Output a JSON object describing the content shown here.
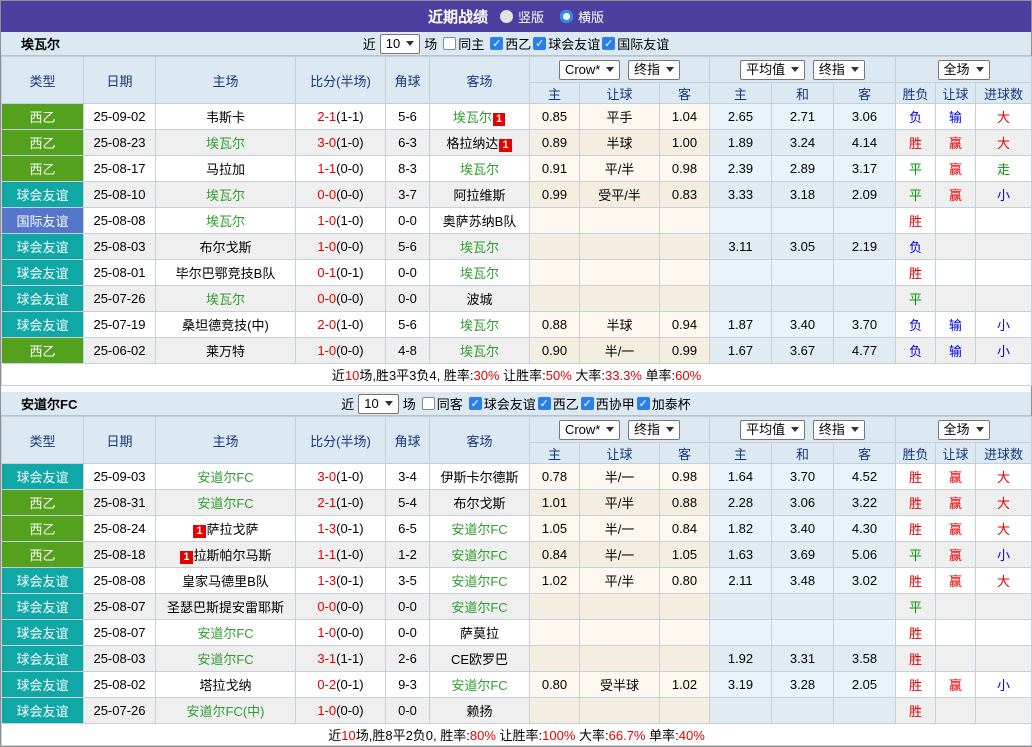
{
  "title_bar": {
    "title": "近期战绩",
    "vertical_label": "竖版",
    "horizontal_label": "横版"
  },
  "filter_shared": {
    "near_label": "近",
    "count": "10",
    "games_label": "场"
  },
  "table_header": {
    "col_type": "类型",
    "col_date": "日期",
    "col_home": "主场",
    "col_score": "比分(半场)",
    "col_corner": "角球",
    "col_away": "客场",
    "dd_odds": "Crow*",
    "dd_final": "终指",
    "dd_avg": "平均值",
    "dd_scope": "全场",
    "odds_sub": [
      "主",
      "让球",
      "客"
    ],
    "avg_sub": [
      "主",
      "和",
      "客"
    ],
    "result_sub": [
      "胜负",
      "让球",
      "进球数"
    ]
  },
  "colors": {
    "accent_purple": "#4b3fa0",
    "league_green": "#54a11e",
    "league_teal": "#10a7a7",
    "league_blue": "#5576cb",
    "win_red": "#e60000",
    "lose_blue": "#0000e0",
    "draw_green": "#009900",
    "team_green": "#2f9e2f"
  },
  "sections": [
    {
      "team": "埃瓦尔",
      "filter": {
        "same": "同主",
        "same_checked": false,
        "leagues": [
          "西乙",
          "球会友谊",
          "国际友谊"
        ]
      },
      "rows": [
        {
          "type": "西乙",
          "tc": "g",
          "date": "25-09-02",
          "home": {
            "t": "韦斯卡"
          },
          "score": "2-1",
          "half": "(1-1)",
          "corner": "5-6",
          "away": {
            "t": "埃瓦尔",
            "g": 1,
            "card": "1",
            "cpos": "after"
          },
          "o": [
            "0.85",
            "平手",
            "1.04"
          ],
          "a": [
            "2.65",
            "2.71",
            "3.06"
          ],
          "r": [
            [
              "负",
              "b"
            ],
            [
              "输",
              "b"
            ],
            [
              "大",
              "r"
            ]
          ]
        },
        {
          "type": "西乙",
          "tc": "g",
          "date": "25-08-23",
          "home": {
            "t": "埃瓦尔",
            "g": 1
          },
          "score": "3-0",
          "half": "(1-0)",
          "corner": "6-3",
          "away": {
            "t": "格拉纳达",
            "card": "1",
            "cpos": "after"
          },
          "o": [
            "0.89",
            "半球",
            "1.00"
          ],
          "a": [
            "1.89",
            "3.24",
            "4.14"
          ],
          "r": [
            [
              "胜",
              "r"
            ],
            [
              "赢",
              "r"
            ],
            [
              "大",
              "r"
            ]
          ]
        },
        {
          "type": "西乙",
          "tc": "g",
          "date": "25-08-17",
          "home": {
            "t": "马拉加"
          },
          "score": "1-1",
          "half": "(0-0)",
          "corner": "8-3",
          "away": {
            "t": "埃瓦尔",
            "g": 1
          },
          "o": [
            "0.91",
            "平/半",
            "0.98"
          ],
          "a": [
            "2.39",
            "2.89",
            "3.17"
          ],
          "r": [
            [
              "平",
              "g"
            ],
            [
              "赢",
              "r"
            ],
            [
              "走",
              "g"
            ]
          ]
        },
        {
          "type": "球会友谊",
          "tc": "t",
          "date": "25-08-10",
          "home": {
            "t": "埃瓦尔",
            "g": 1
          },
          "score": "0-0",
          "half": "(0-0)",
          "corner": "3-7",
          "away": {
            "t": "阿拉维斯"
          },
          "o": [
            "0.99",
            "受平/半",
            "0.83"
          ],
          "a": [
            "3.33",
            "3.18",
            "2.09"
          ],
          "r": [
            [
              "平",
              "g"
            ],
            [
              "赢",
              "r"
            ],
            [
              "小",
              "b"
            ]
          ]
        },
        {
          "type": "国际友谊",
          "tc": "b",
          "date": "25-08-08",
          "home": {
            "t": "埃瓦尔",
            "g": 1
          },
          "score": "1-0",
          "half": "(1-0)",
          "corner": "0-0",
          "away": {
            "t": "奥萨苏纳B队"
          },
          "o": [
            "",
            "",
            ""
          ],
          "a": [
            "",
            "",
            ""
          ],
          "r": [
            [
              "胜",
              "r"
            ],
            [
              "",
              ""
            ],
            [
              "",
              ""
            ]
          ]
        },
        {
          "type": "球会友谊",
          "tc": "t",
          "date": "25-08-03",
          "home": {
            "t": "布尔戈斯"
          },
          "score": "1-0",
          "half": "(0-0)",
          "corner": "5-6",
          "away": {
            "t": "埃瓦尔",
            "g": 1
          },
          "o": [
            "",
            "",
            ""
          ],
          "a": [
            "3.11",
            "3.05",
            "2.19"
          ],
          "r": [
            [
              "负",
              "b"
            ],
            [
              "",
              ""
            ],
            [
              "",
              ""
            ]
          ]
        },
        {
          "type": "球会友谊",
          "tc": "t",
          "date": "25-08-01",
          "home": {
            "t": "毕尔巴鄂竞技B队"
          },
          "score": "0-1",
          "half": "(0-1)",
          "corner": "0-0",
          "away": {
            "t": "埃瓦尔",
            "g": 1
          },
          "o": [
            "",
            "",
            ""
          ],
          "a": [
            "",
            "",
            ""
          ],
          "r": [
            [
              "胜",
              "r"
            ],
            [
              "",
              ""
            ],
            [
              "",
              ""
            ]
          ]
        },
        {
          "type": "球会友谊",
          "tc": "t",
          "date": "25-07-26",
          "home": {
            "t": "埃瓦尔",
            "g": 1
          },
          "score": "0-0",
          "half": "(0-0)",
          "corner": "0-0",
          "away": {
            "t": "波城"
          },
          "o": [
            "",
            "",
            ""
          ],
          "a": [
            "",
            "",
            ""
          ],
          "r": [
            [
              "平",
              "g"
            ],
            [
              "",
              ""
            ],
            [
              "",
              ""
            ]
          ]
        },
        {
          "type": "球会友谊",
          "tc": "t",
          "date": "25-07-19",
          "home": {
            "t": "桑坦德竞技(中)"
          },
          "score": "2-0",
          "half": "(1-0)",
          "corner": "5-6",
          "away": {
            "t": "埃瓦尔",
            "g": 1
          },
          "o": [
            "0.88",
            "半球",
            "0.94"
          ],
          "a": [
            "1.87",
            "3.40",
            "3.70"
          ],
          "r": [
            [
              "负",
              "b"
            ],
            [
              "输",
              "b"
            ],
            [
              "小",
              "b"
            ]
          ]
        },
        {
          "type": "西乙",
          "tc": "g",
          "date": "25-06-02",
          "home": {
            "t": "莱万特"
          },
          "score": "1-0",
          "half": "(0-0)",
          "corner": "4-8",
          "away": {
            "t": "埃瓦尔",
            "g": 1
          },
          "o": [
            "0.90",
            "半/一",
            "0.99"
          ],
          "a": [
            "1.67",
            "3.67",
            "4.77"
          ],
          "r": [
            [
              "负",
              "b"
            ],
            [
              "输",
              "b"
            ],
            [
              "小",
              "b"
            ]
          ]
        }
      ],
      "summary": [
        [
          "近"
        ],
        [
          "10",
          "r"
        ],
        [
          "场,胜3平3负4, 胜率:"
        ],
        [
          "30%",
          "r"
        ],
        [
          " 让胜率:"
        ],
        [
          "50%",
          "r"
        ],
        [
          " 大率:"
        ],
        [
          "33.3%",
          "r"
        ],
        [
          " 单率:"
        ],
        [
          "60%",
          "r"
        ]
      ]
    },
    {
      "team": "安道尔FC",
      "filter": {
        "same": "同客",
        "same_checked": false,
        "leagues": [
          "球会友谊",
          "西乙",
          "西协甲",
          "加泰杯"
        ]
      },
      "rows": [
        {
          "type": "球会友谊",
          "tc": "t",
          "date": "25-09-03",
          "home": {
            "t": "安道尔FC",
            "g": 1
          },
          "score": "3-0",
          "half": "(1-0)",
          "corner": "3-4",
          "away": {
            "t": "伊斯卡尔德斯"
          },
          "o": [
            "0.78",
            "半/一",
            "0.98"
          ],
          "a": [
            "1.64",
            "3.70",
            "4.52"
          ],
          "r": [
            [
              "胜",
              "r"
            ],
            [
              "赢",
              "r"
            ],
            [
              "大",
              "r"
            ]
          ]
        },
        {
          "type": "西乙",
          "tc": "g",
          "date": "25-08-31",
          "home": {
            "t": "安道尔FC",
            "g": 1
          },
          "score": "2-1",
          "half": "(1-0)",
          "corner": "5-4",
          "away": {
            "t": "布尔戈斯"
          },
          "o": [
            "1.01",
            "平/半",
            "0.88"
          ],
          "a": [
            "2.28",
            "3.06",
            "3.22"
          ],
          "r": [
            [
              "胜",
              "r"
            ],
            [
              "赢",
              "r"
            ],
            [
              "大",
              "r"
            ]
          ]
        },
        {
          "type": "西乙",
          "tc": "g",
          "date": "25-08-24",
          "home": {
            "t": "萨拉戈萨",
            "card": "1",
            "cpos": "before"
          },
          "score": "1-3",
          "half": "(0-1)",
          "corner": "6-5",
          "away": {
            "t": "安道尔FC",
            "g": 1
          },
          "o": [
            "1.05",
            "半/一",
            "0.84"
          ],
          "a": [
            "1.82",
            "3.40",
            "4.30"
          ],
          "r": [
            [
              "胜",
              "r"
            ],
            [
              "赢",
              "r"
            ],
            [
              "大",
              "r"
            ]
          ]
        },
        {
          "type": "西乙",
          "tc": "g",
          "date": "25-08-18",
          "home": {
            "t": "拉斯帕尔马斯",
            "card": "1",
            "cpos": "before"
          },
          "score": "1-1",
          "half": "(1-0)",
          "corner": "1-2",
          "away": {
            "t": "安道尔FC",
            "g": 1
          },
          "o": [
            "0.84",
            "半/一",
            "1.05"
          ],
          "a": [
            "1.63",
            "3.69",
            "5.06"
          ],
          "r": [
            [
              "平",
              "g"
            ],
            [
              "赢",
              "r"
            ],
            [
              "小",
              "b"
            ]
          ]
        },
        {
          "type": "球会友谊",
          "tc": "t",
          "date": "25-08-08",
          "home": {
            "t": "皇家马德里B队"
          },
          "score": "1-3",
          "half": "(0-1)",
          "corner": "3-5",
          "away": {
            "t": "安道尔FC",
            "g": 1
          },
          "o": [
            "1.02",
            "平/半",
            "0.80"
          ],
          "a": [
            "2.11",
            "3.48",
            "3.02"
          ],
          "r": [
            [
              "胜",
              "r"
            ],
            [
              "赢",
              "r"
            ],
            [
              "大",
              "r"
            ]
          ]
        },
        {
          "type": "球会友谊",
          "tc": "t",
          "date": "25-08-07",
          "home": {
            "t": "圣瑟巴斯提安雷耶斯"
          },
          "score": "0-0",
          "half": "(0-0)",
          "corner": "0-0",
          "away": {
            "t": "安道尔FC",
            "g": 1
          },
          "o": [
            "",
            "",
            ""
          ],
          "a": [
            "",
            "",
            ""
          ],
          "r": [
            [
              "平",
              "g"
            ],
            [
              "",
              ""
            ],
            [
              "",
              ""
            ]
          ]
        },
        {
          "type": "球会友谊",
          "tc": "t",
          "date": "25-08-07",
          "home": {
            "t": "安道尔FC",
            "g": 1
          },
          "score": "1-0",
          "half": "(0-0)",
          "corner": "0-0",
          "away": {
            "t": "萨莫拉"
          },
          "o": [
            "",
            "",
            ""
          ],
          "a": [
            "",
            "",
            ""
          ],
          "r": [
            [
              "胜",
              "r"
            ],
            [
              "",
              ""
            ],
            [
              "",
              ""
            ]
          ]
        },
        {
          "type": "球会友谊",
          "tc": "t",
          "date": "25-08-03",
          "home": {
            "t": "安道尔FC",
            "g": 1
          },
          "score": "3-1",
          "half": "(1-1)",
          "corner": "2-6",
          "away": {
            "t": "CE欧罗巴"
          },
          "o": [
            "",
            "",
            ""
          ],
          "a": [
            "1.92",
            "3.31",
            "3.58"
          ],
          "r": [
            [
              "胜",
              "r"
            ],
            [
              "",
              ""
            ],
            [
              "",
              ""
            ]
          ]
        },
        {
          "type": "球会友谊",
          "tc": "t",
          "date": "25-08-02",
          "home": {
            "t": "塔拉戈纳"
          },
          "score": "0-2",
          "half": "(0-1)",
          "corner": "9-3",
          "away": {
            "t": "安道尔FC",
            "g": 1
          },
          "o": [
            "0.80",
            "受半球",
            "1.02"
          ],
          "a": [
            "3.19",
            "3.28",
            "2.05"
          ],
          "r": [
            [
              "胜",
              "r"
            ],
            [
              "赢",
              "r"
            ],
            [
              "小",
              "b"
            ]
          ]
        },
        {
          "type": "球会友谊",
          "tc": "t",
          "date": "25-07-26",
          "home": {
            "t": "安道尔FC(中)",
            "g": 1
          },
          "score": "1-0",
          "half": "(0-0)",
          "corner": "0-0",
          "away": {
            "t": "赖扬"
          },
          "o": [
            "",
            "",
            ""
          ],
          "a": [
            "",
            "",
            ""
          ],
          "r": [
            [
              "胜",
              "r"
            ],
            [
              "",
              ""
            ],
            [
              "",
              ""
            ]
          ]
        }
      ],
      "summary": [
        [
          "近"
        ],
        [
          "10",
          "r"
        ],
        [
          "场,胜8平2负0, 胜率:"
        ],
        [
          "80%",
          "r"
        ],
        [
          " 让胜率:"
        ],
        [
          "100%",
          "r"
        ],
        [
          " 大率:"
        ],
        [
          "66.7%",
          "r"
        ],
        [
          " 单率:"
        ],
        [
          "40%",
          "r"
        ]
      ]
    }
  ]
}
